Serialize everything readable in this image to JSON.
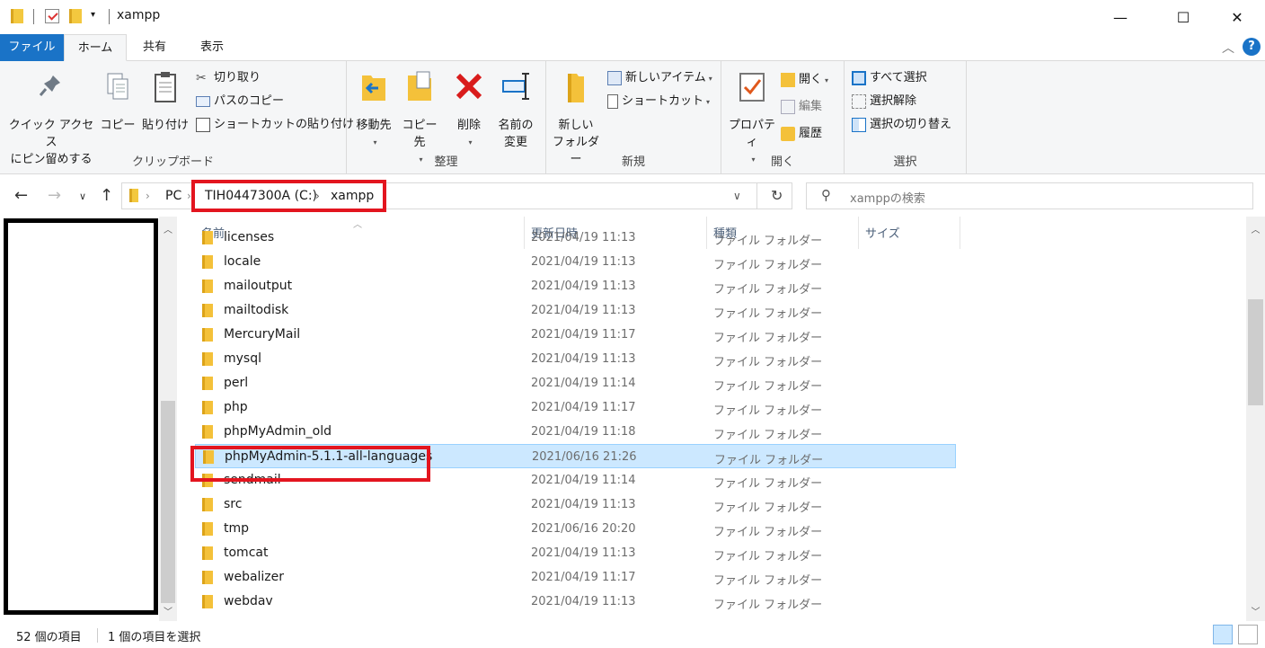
{
  "window": {
    "title": "xampp",
    "minimize": "—",
    "maximize": "☐",
    "close": "✕"
  },
  "tabs": {
    "file": "ファイル",
    "home": "ホーム",
    "share": "共有",
    "view": "表示",
    "help": "?"
  },
  "ribbon": {
    "clipboard": {
      "label": "クリップボード",
      "pin_line1": "クイック アクセス",
      "pin_line2": "にピン留めする",
      "copy": "コピー",
      "paste": "貼り付け",
      "cut": "切り取り",
      "copy_path": "パスのコピー",
      "paste_shortcut": "ショートカットの貼り付け"
    },
    "organize": {
      "label": "整理",
      "move_to": "移動先",
      "copy_to": "コピー先",
      "delete": "削除",
      "rename_line1": "名前の",
      "rename_line2": "変更"
    },
    "new": {
      "label": "新規",
      "new_folder_line1": "新しい",
      "new_folder_line2": "フォルダー",
      "new_item": "新しいアイテム",
      "shortcut": "ショートカット"
    },
    "open": {
      "label": "開く",
      "properties": "プロパティ",
      "open": "開く",
      "edit": "編集",
      "history": "履歴"
    },
    "select": {
      "label": "選択",
      "select_all": "すべて選択",
      "select_none": "選択解除",
      "invert": "選択の切り替え"
    }
  },
  "address": {
    "crumbs": [
      "PC",
      "TIH0447300A (C:)",
      "xampp"
    ],
    "search_placeholder": "xamppの検索"
  },
  "columns": {
    "name": "名前",
    "date": "更新日時",
    "type": "種類",
    "size": "サイズ"
  },
  "files": [
    {
      "name": "licenses",
      "date": "2021/04/19 11:13",
      "type": "ファイル フォルダー"
    },
    {
      "name": "locale",
      "date": "2021/04/19 11:13",
      "type": "ファイル フォルダー"
    },
    {
      "name": "mailoutput",
      "date": "2021/04/19 11:13",
      "type": "ファイル フォルダー"
    },
    {
      "name": "mailtodisk",
      "date": "2021/04/19 11:13",
      "type": "ファイル フォルダー"
    },
    {
      "name": "MercuryMail",
      "date": "2021/04/19 11:17",
      "type": "ファイル フォルダー"
    },
    {
      "name": "mysql",
      "date": "2021/04/19 11:13",
      "type": "ファイル フォルダー"
    },
    {
      "name": "perl",
      "date": "2021/04/19 11:14",
      "type": "ファイル フォルダー"
    },
    {
      "name": "php",
      "date": "2021/04/19 11:17",
      "type": "ファイル フォルダー"
    },
    {
      "name": "phpMyAdmin_old",
      "date": "2021/04/19 11:18",
      "type": "ファイル フォルダー"
    },
    {
      "name": "phpMyAdmin-5.1.1-all-languages",
      "date": "2021/06/16 21:26",
      "type": "ファイル フォルダー",
      "selected": true
    },
    {
      "name": "sendmail",
      "date": "2021/04/19 11:14",
      "type": "ファイル フォルダー"
    },
    {
      "name": "src",
      "date": "2021/04/19 11:13",
      "type": "ファイル フォルダー"
    },
    {
      "name": "tmp",
      "date": "2021/06/16 20:20",
      "type": "ファイル フォルダー"
    },
    {
      "name": "tomcat",
      "date": "2021/04/19 11:13",
      "type": "ファイル フォルダー"
    },
    {
      "name": "webalizer",
      "date": "2021/04/19 11:17",
      "type": "ファイル フォルダー"
    },
    {
      "name": "webdav",
      "date": "2021/04/19 11:13",
      "type": "ファイル フォルダー"
    }
  ],
  "status": {
    "item_count": "52 個の項目",
    "selected_count": "1 個の項目を選択"
  },
  "colors": {
    "accent": "#1a73c7",
    "highlight": "#e3151f",
    "selection": "#cce8ff"
  }
}
